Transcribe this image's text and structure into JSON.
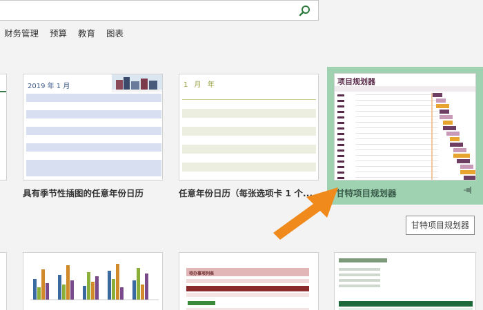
{
  "search": {
    "placeholder": "",
    "value": ""
  },
  "categories": [
    "财务管理",
    "预算",
    "教育",
    "图表"
  ],
  "templates": {
    "row1": [
      {
        "label": "具有季节性插图的任意年份日历",
        "cal_title": "2019 年 1 月"
      },
      {
        "label": "任意年份日历（每张选项卡 1 个...",
        "cal_title": "1 月 年"
      },
      {
        "label": "甘特项目规划器",
        "gantt_title": "项目规划器"
      }
    ]
  },
  "tooltip": "甘特项目规划器",
  "todo_title": "待办事项列表",
  "colors": {
    "selected": "#9ed2b0",
    "arrow": "#f08a1c",
    "gantt_dark": "#6e3f62",
    "gantt_light": "#c89ab8",
    "gantt_orange": "#e7a530"
  }
}
